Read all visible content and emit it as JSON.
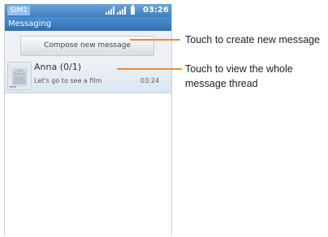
{
  "status_bar": {
    "sim_label": "SIM1",
    "time": "03:26"
  },
  "app_title": "Messaging",
  "compose_button": "Compose new message",
  "threads": [
    {
      "name": "Anna  (0/1)",
      "snippet": "Let's go to see a film",
      "time": "03:24"
    }
  ],
  "callouts": [
    {
      "text": "Touch to create new message"
    },
    {
      "text": "Touch to view the whole message thread"
    }
  ],
  "colors": {
    "accent": "#f08a2e",
    "titlebar": "#3f7fc0"
  }
}
